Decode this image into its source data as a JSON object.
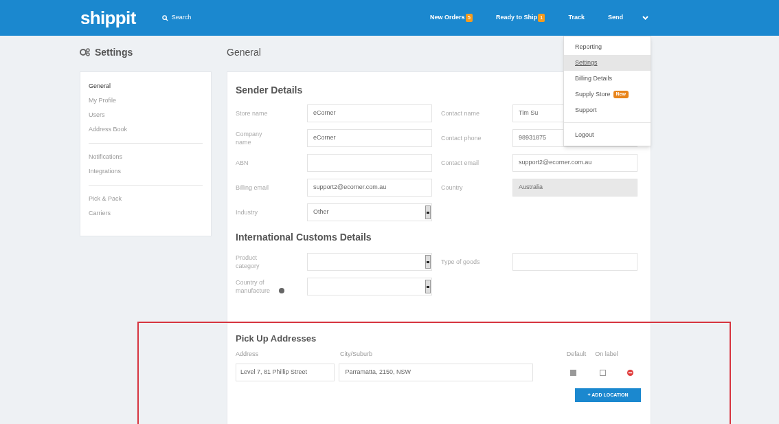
{
  "topbar": {
    "logo": "shippit",
    "search": "Search",
    "nav": [
      {
        "label": "New Orders",
        "badge": "5"
      },
      {
        "label": "Ready to Ship",
        "badge": "1"
      },
      {
        "label": "Track"
      },
      {
        "label": "Send"
      }
    ],
    "menu_expanded": true
  },
  "menu": {
    "items": [
      {
        "label": "Reporting",
        "selected": false
      },
      {
        "label": "Settings",
        "selected": true
      },
      {
        "label": "Billing Details",
        "selected": false
      },
      {
        "label": "Supply Store",
        "selected": false,
        "badge": "New"
      },
      {
        "label": "Support",
        "selected": false
      }
    ],
    "footer_items": [
      {
        "label": "Logout",
        "selected": false
      }
    ]
  },
  "sidebar": {
    "title": "Settings",
    "groups": [
      [
        {
          "label": "General",
          "selected": true
        },
        {
          "label": "My Profile",
          "selected": false
        },
        {
          "label": "Users",
          "selected": false
        },
        {
          "label": "Address Book",
          "selected": false
        }
      ],
      [
        {
          "label": "Notifications",
          "selected": false
        },
        {
          "label": "Integrations",
          "selected": false
        }
      ],
      [
        {
          "label": "Pick & Pack",
          "selected": false
        },
        {
          "label": "Carriers",
          "selected": false
        }
      ]
    ]
  },
  "page_title": "General",
  "sender": {
    "title": "Sender Details",
    "rows": [
      [
        {
          "label": "Store name",
          "kind": "text",
          "value": "eCorner"
        },
        {
          "label": "Contact name",
          "kind": "text",
          "value": "Tim Su"
        }
      ],
      [
        {
          "label": "Company name",
          "kind": "text",
          "value": "eCorner"
        },
        {
          "label": "Contact phone",
          "kind": "text",
          "value": "98931875"
        }
      ],
      [
        {
          "label": "ABN",
          "kind": "text"
        },
        {
          "label": "Contact email",
          "kind": "text",
          "value": "support2@ecorner.com.au"
        }
      ],
      [
        {
          "label": "Billing email",
          "kind": "text",
          "value": "support2@ecorner.com.au"
        },
        {
          "label": "Country",
          "kind": "readonly",
          "value": "Australia"
        }
      ],
      [
        {
          "label": "Industry",
          "kind": "select",
          "value": "Other"
        }
      ]
    ]
  },
  "customs": {
    "title": "International Customs Details",
    "rows": [
      [
        {
          "label": "Product category",
          "kind": "select"
        },
        {
          "label": "Type of goods",
          "kind": "text"
        }
      ],
      [
        {
          "label": "Country of manufacture",
          "kind": "select",
          "info": true
        }
      ]
    ]
  },
  "pickup": {
    "title": "Pick Up Addresses",
    "columns": [
      "Address",
      "City/Suburb",
      "Default",
      "On label"
    ],
    "rows": [
      {
        "address": "Level 7, 81 Phillip Street",
        "city": "Parramatta, 2150, NSW",
        "default": true,
        "on_label": false
      }
    ],
    "button": "+ ADD LOCATION"
  },
  "highlight": true
}
